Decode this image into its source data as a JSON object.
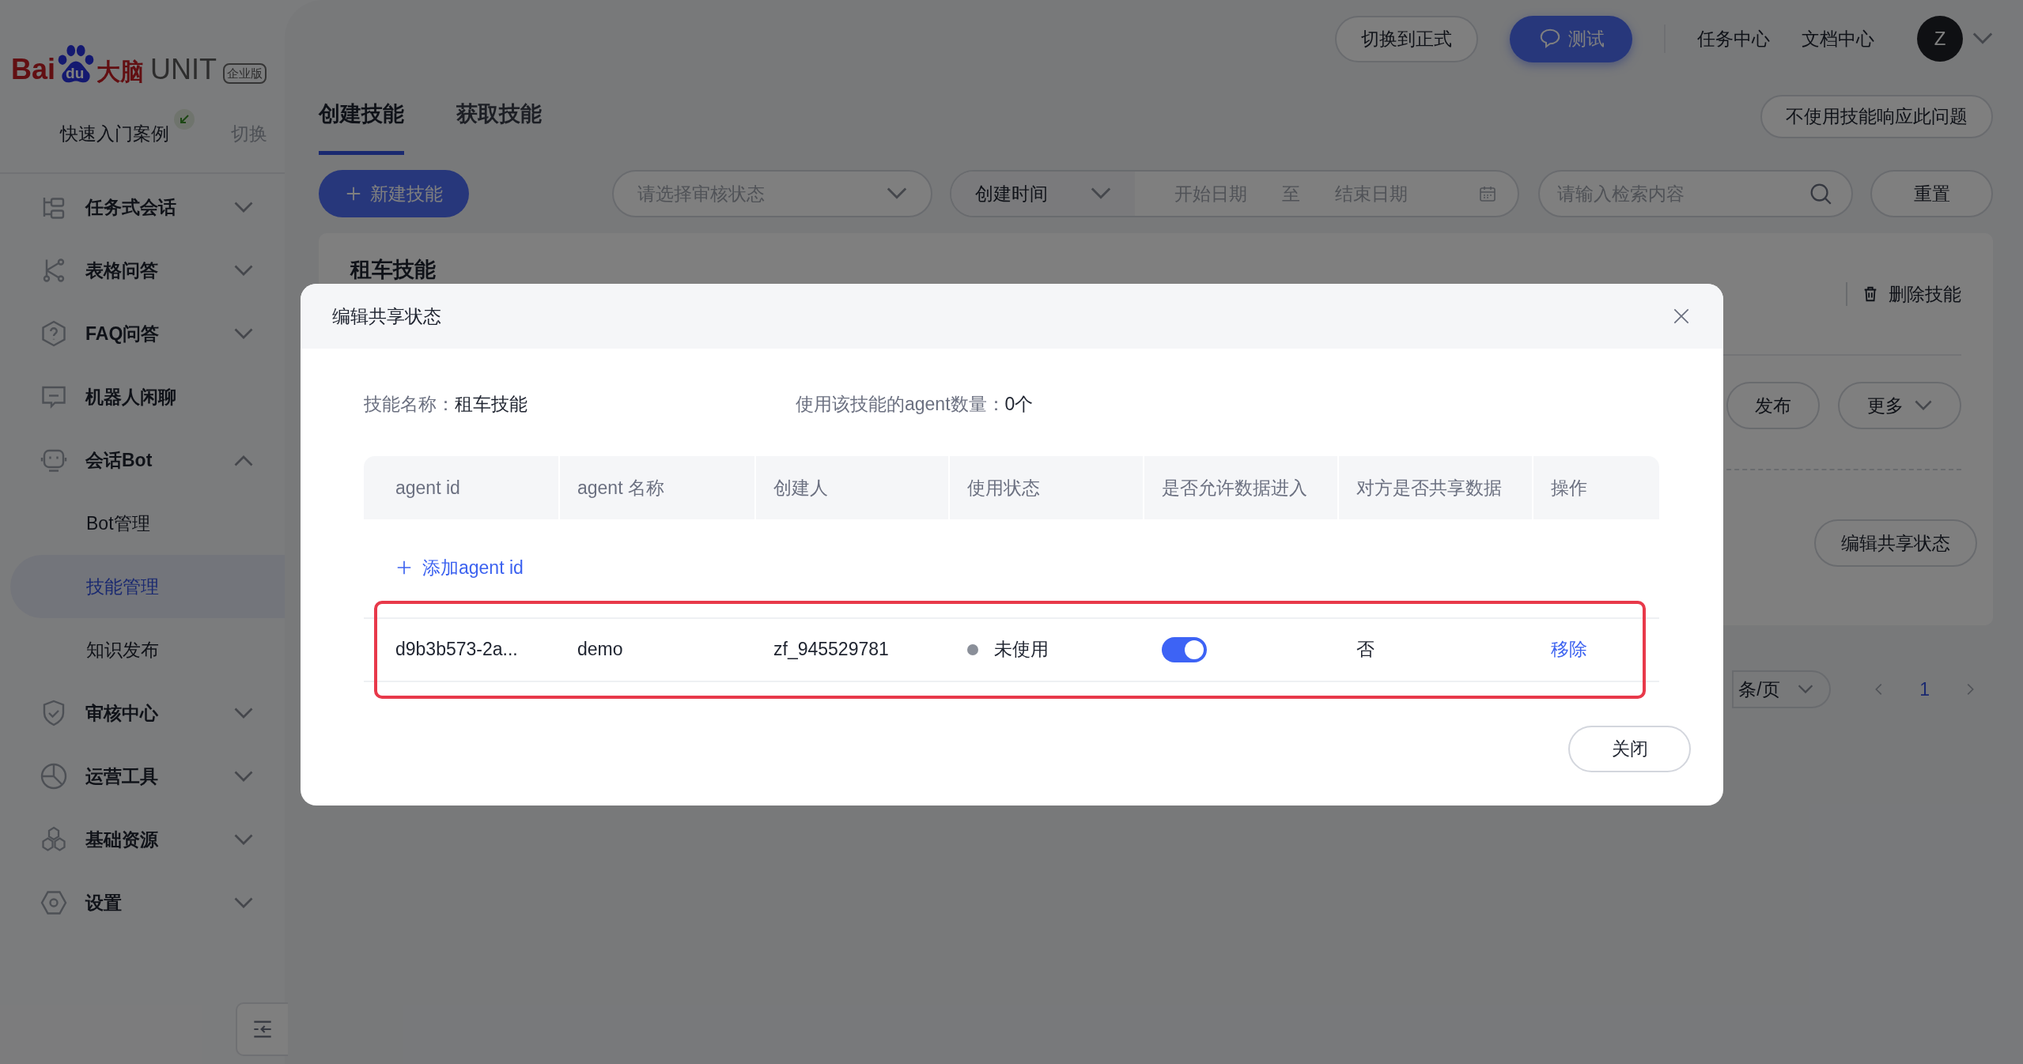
{
  "logo": {
    "brand_left": "Bai",
    "brand_paw": "du",
    "brand_right": "大脑",
    "product": "UNIT",
    "badge": "企业版"
  },
  "quick_start": {
    "label": "快速入门案例",
    "switch": "切换"
  },
  "sidebar": {
    "items": [
      {
        "label": "任务式会话",
        "expanded": false
      },
      {
        "label": "表格问答",
        "expanded": false
      },
      {
        "label": "FAQ问答",
        "expanded": false
      },
      {
        "label": "机器人闲聊"
      },
      {
        "label": "会话Bot",
        "expanded": true,
        "children": [
          {
            "label": "Bot管理",
            "selected": false
          },
          {
            "label": "技能管理",
            "selected": true
          },
          {
            "label": "知识发布",
            "selected": false
          }
        ]
      },
      {
        "label": "审核中心",
        "expanded": false
      },
      {
        "label": "运营工具",
        "expanded": false
      },
      {
        "label": "基础资源",
        "expanded": false
      },
      {
        "label": "设置",
        "expanded": false
      }
    ]
  },
  "header": {
    "buttons": [
      {
        "label": "切换到正式",
        "kind": "outline"
      },
      {
        "label": "测试",
        "kind": "primary"
      }
    ],
    "links": [
      "任务中心",
      "文档中心"
    ],
    "avatar": "Z"
  },
  "tabs": [
    {
      "label": "创建技能",
      "selected": true
    },
    {
      "label": "获取技能",
      "selected": false
    }
  ],
  "tab_action": "不使用技能响应此问题",
  "filters": {
    "new_button": "新建技能",
    "status_select": {
      "placeholder": "请选择审核状态"
    },
    "time_select": "创建时间",
    "start_date": {
      "placeholder": "开始日期"
    },
    "range_separator": "至",
    "end_date": {
      "placeholder": "结束日期"
    },
    "search": {
      "placeholder": "请输入检索内容"
    },
    "reset_button": "重置"
  },
  "skill_card": {
    "title": "租车技能",
    "delete": "删除技能",
    "buttons": [
      "发布",
      "更多"
    ],
    "share_button": "编辑共享状态"
  },
  "pagination": {
    "page_size": "条/页",
    "pages": [
      {
        "label": "1",
        "selected": true
      }
    ]
  },
  "modal": {
    "title": "编辑共享状态",
    "fields": [
      {
        "label": "技能名称：",
        "value": "租车技能"
      },
      {
        "label": "使用该技能的agent数量：",
        "value": "0个"
      }
    ],
    "columns": [
      "agent id",
      "agent 名称",
      "创建人",
      "使用状态",
      "是否允许数据进入",
      "对方是否共享数据",
      "操作"
    ],
    "add_link": "添加agent id",
    "rows": [
      {
        "agent_id": "d9b3b573-2a...",
        "agent_name": "demo",
        "creator": "zf_945529781",
        "status": "未使用",
        "allow_data": true,
        "partner_shares": "否",
        "action": "移除",
        "highlighted": true
      }
    ],
    "close_button": "关闭"
  }
}
